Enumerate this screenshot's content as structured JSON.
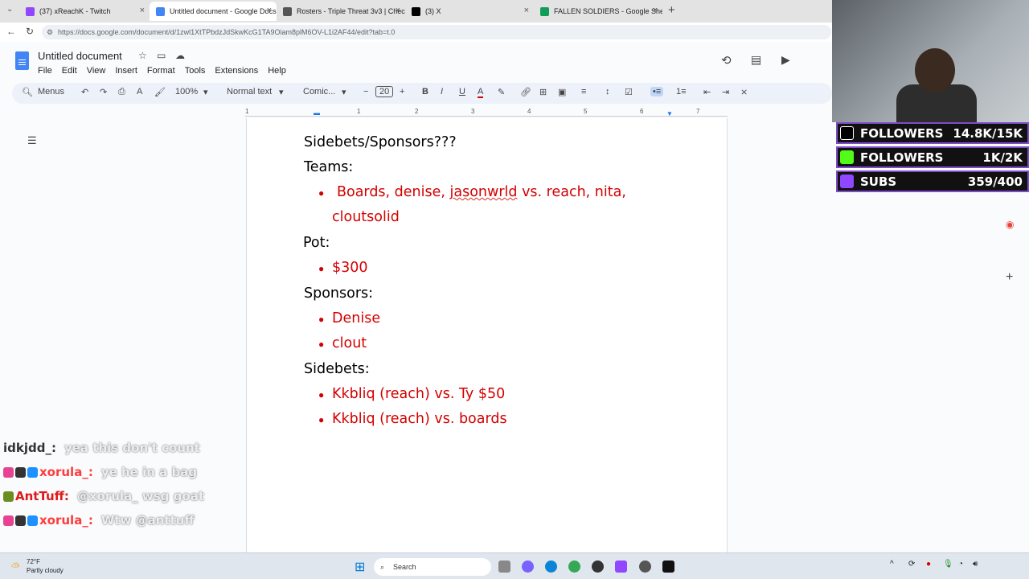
{
  "browser": {
    "tabs": [
      {
        "label": "(37) xReachK - Twitch",
        "color": "#9146ff"
      },
      {
        "label": "Untitled document - Google Docs",
        "color": "#4285f4"
      },
      {
        "label": "Rosters - Triple Threat 3v3 | Check",
        "color": "#555555"
      },
      {
        "label": "(3) X",
        "color": "#000000"
      },
      {
        "label": "FALLEN SOLDIERS - Google Sheets",
        "color": "#0f9d58"
      }
    ],
    "url": "https://docs.google.com/document/d/1zwl1XtTPbdzJdSkwKcG1TA9Oiam8plM6OV-L1i2AF44/edit?tab=t.0"
  },
  "doc": {
    "title": "Untitled document",
    "menu": [
      "File",
      "Edit",
      "View",
      "Insert",
      "Format",
      "Tools",
      "Extensions",
      "Help"
    ],
    "toolbar": {
      "menus": "Menus",
      "zoom": "100%",
      "style": "Normal text",
      "font": "Comic...",
      "size": "20"
    },
    "ruler": [
      "1",
      "1",
      "2",
      "3",
      "4",
      "5",
      "6",
      "7"
    ],
    "lines": [
      {
        "text": "Sidebets/Sponsors???",
        "red": false,
        "bullet": false
      },
      {
        "text": " Teams:",
        "red": false,
        "bullet": false
      },
      {
        "text": "Boards, denise, ",
        "red": true,
        "bullet": true,
        "spell": "jasonwrld",
        "tail": " vs. reach, nita,"
      },
      {
        "text": "cloutsolid",
        "red": true,
        "bullet": false
      },
      {
        "text": "Pot:",
        "red": false,
        "bullet": false
      },
      {
        "text": "$300",
        "red": true,
        "bullet": true
      },
      {
        "text": "Sponsors:",
        "red": false,
        "bullet": false
      },
      {
        "text": "Denise",
        "red": true,
        "bullet": true
      },
      {
        "text": "clout",
        "red": true,
        "bullet": true
      },
      {
        "text": "Sidebets:",
        "red": false,
        "bullet": false
      },
      {
        "text": "Kkbliq (reach) vs. Ty $50",
        "red": true,
        "bullet": true
      },
      {
        "text": "Kkbliq (reach) vs. boards",
        "red": true,
        "bullet": true
      }
    ]
  },
  "stream": {
    "stats": [
      {
        "label": "FOLLOWERS",
        "value": "14.8K/15K",
        "icon": "tiktok-icon",
        "color": "#000000"
      },
      {
        "label": "FOLLOWERS",
        "value": "1K/2K",
        "icon": "kick-icon",
        "color": "#53fc18"
      },
      {
        "label": "SUBS",
        "value": "359/400",
        "icon": "twitch-icon",
        "color": "#9146ff"
      }
    ],
    "chat": [
      {
        "user": "idkjdd_:",
        "msg": "yea this don't count",
        "color": "#333333",
        "badges": false
      },
      {
        "user": "xorula_:",
        "msg": "ye he in a bag",
        "color": "#ff3b3b",
        "badges": true
      },
      {
        "user": "AntTuff:",
        "msg": "@xorula_ wsg goat",
        "color": "#e01818",
        "badges": true
      },
      {
        "user": "xorula_:",
        "msg": "Wtw @anttuff",
        "color": "#ff3b3b",
        "badges": true
      }
    ]
  },
  "taskbar": {
    "temp": "72°F",
    "weather": "Partly cloudy",
    "search": "Search"
  }
}
